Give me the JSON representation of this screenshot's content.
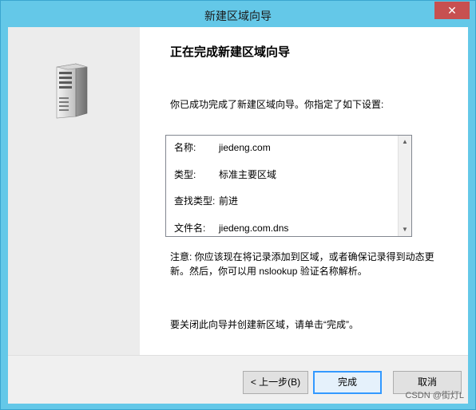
{
  "window": {
    "title": "新建区域向导",
    "close_symbol": "✕"
  },
  "wizard": {
    "heading": "正在完成新建区域向导",
    "intro": "你已成功完成了新建区域向导。你指定了如下设置:",
    "settings": [
      {
        "label": "名称:",
        "value": "jiedeng.com"
      },
      {
        "label": "类型:",
        "value": "标准主要区域"
      },
      {
        "label": "查找类型:",
        "value": "前进"
      },
      {
        "label": "文件名:",
        "value": "jiedeng.com.dns"
      }
    ],
    "note_line1": "注意: 你应该现在将记录添加到区域，或者确保记录得到动态更",
    "note_line2": "新。然后，你可以用 nslookup 验证名称解析。",
    "finish_text": "要关闭此向导并创建新区域，请单击“完成”。"
  },
  "buttons": {
    "back": "< 上一步(B)",
    "finish": "完成",
    "cancel": "取消"
  },
  "scrollbar": {
    "up_icon": "chevron-up-icon",
    "down_icon": "chevron-down-icon"
  },
  "watermark": "CSDN @街灯L"
}
